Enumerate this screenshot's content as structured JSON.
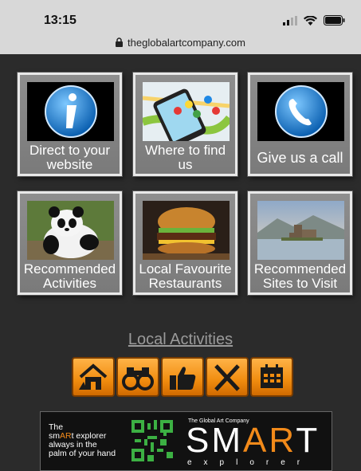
{
  "status": {
    "time": "13:15"
  },
  "address": {
    "url": "theglobalartcompany.com"
  },
  "tiles": [
    {
      "label": "Direct to your website",
      "icon": "info-icon"
    },
    {
      "label": "Where to find us",
      "icon": "map-phone-icon"
    },
    {
      "label": "Give us a call",
      "icon": "phone-icon"
    },
    {
      "label": "Recommended Activities",
      "icon": "panda-photo"
    },
    {
      "label": "Local Favourite Restaurants",
      "icon": "burger-photo"
    },
    {
      "label": "Recommended Sites to Visit",
      "icon": "castle-photo"
    }
  ],
  "section": {
    "title": "Local Activities"
  },
  "icon_buttons": [
    "home-icon",
    "binoculars-icon",
    "thumbs-up-icon",
    "fork-knife-icon",
    "calendar-icon"
  ],
  "banner": {
    "line1": "The",
    "line2_pre": "sm",
    "line2_ar": "AR",
    "line2_post": "t explorer",
    "line3": "always in the",
    "line4": "palm of your hand",
    "company": "The Global Art Company",
    "brand_pre": "SM",
    "brand_ar": "AR",
    "brand_post": "T",
    "tagline": "explorer"
  },
  "colors": {
    "accent": "#f28a1a",
    "background": "#2b2b2b"
  }
}
